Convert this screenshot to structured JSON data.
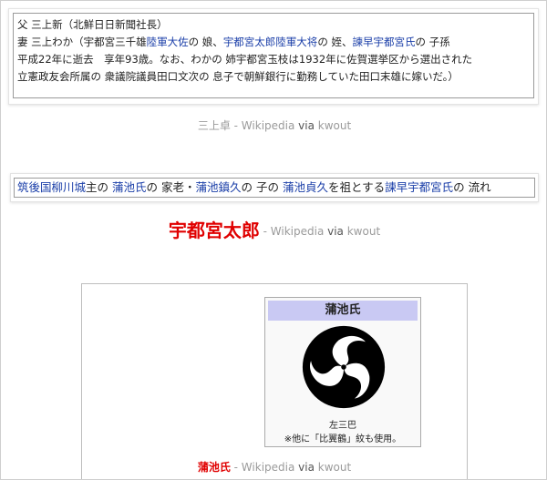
{
  "clip1": {
    "line1": "父 三上新（北鮮日日新聞社長）",
    "line2": {
      "t1": "妻 三上わか（宇都宮三千雄",
      "l1": "陸軍大佐",
      "t2": "の 娘、",
      "l2": "宇都宮太郎",
      "l3": "陸軍大将",
      "t3": "の 姪、",
      "l4": "諫早宇都宮氏",
      "t4": "の 子孫"
    },
    "line3": "平成22年に逝去　享年93歳。なお、わかの 姉宇都宮玉枝は1932年に佐賀選挙区から選出された",
    "line4": "立憲政友会所属の 衆議院議員田口文次の 息子で朝鮮銀行に勤務していた田口末雄に嫁いだ。）"
  },
  "caption1": {
    "title": "三上卓",
    "sep": " - Wikipedia ",
    "via": "via",
    "kwout": " kwout"
  },
  "clip2": {
    "l1": "筑後国柳川城",
    "t1": "主の ",
    "l2": "蒲池氏",
    "t2": "の 家老・",
    "l3": "蒲池鎮久",
    "t3": "の 子の ",
    "l4": "蒲池貞久",
    "t4": "を祖とする",
    "l5": "諫早宇都宮氏",
    "t5": "の 流れ"
  },
  "caption2": {
    "title": "宇都宮太郎",
    "sep": " - Wikipedia ",
    "via": "via",
    "kwout": " kwout"
  },
  "clip3": {
    "infobox_title": "蒲池氏",
    "mon_icon": "mitsudomoe-icon",
    "mon_label": "左三巴",
    "mon_note": "※他に「比翼鶴」紋も使用。"
  },
  "caption3": {
    "title": "蒲池氏",
    "sep": " - Wikipedia ",
    "via": "via",
    "kwout": " kwout"
  }
}
